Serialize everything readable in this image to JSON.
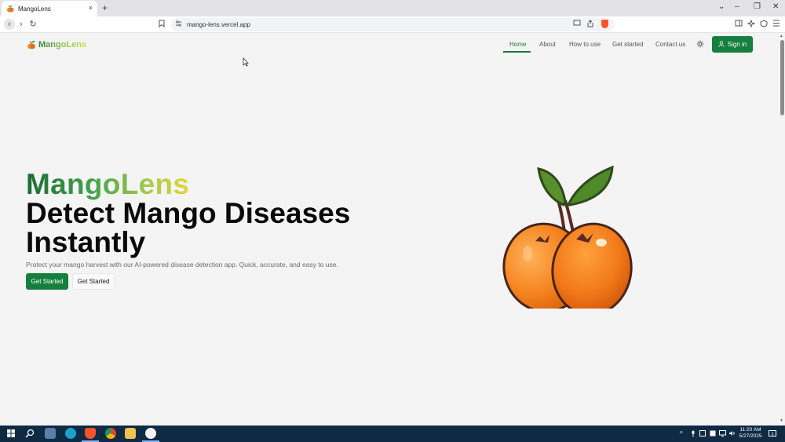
{
  "browser": {
    "tab_title": "MangoLens",
    "tab_close": "×",
    "new_tab": "+",
    "url": "mango-lens.vercel.app",
    "window_controls": [
      "⌄",
      "–",
      "❐",
      "✕"
    ],
    "nav_icons": {
      "back": "‹",
      "forward": "›",
      "reload": "↻",
      "bookmark": "bookmark-icon"
    }
  },
  "site": {
    "brand": "MangoLens",
    "nav": [
      {
        "label": "Home",
        "active": true
      },
      {
        "label": "About",
        "active": false
      },
      {
        "label": "How to use",
        "active": false
      },
      {
        "label": "Get started",
        "active": false
      },
      {
        "label": "Contact us",
        "active": false
      }
    ],
    "theme_toggle_icon": "sun-icon",
    "signin_label": "Sign in",
    "accent_color": "#15803d"
  },
  "hero": {
    "kicker": "MangoLens",
    "title": "Detect Mango Diseases Instantly",
    "subtitle": "Protect your mango harvest with our AI-powered disease detection app. Quick, accurate, and easy to use.",
    "primary_button": "Get Started",
    "secondary_button": "Get Started"
  },
  "taskbar": {
    "time": "11:20 AM",
    "date": "5/27/2025",
    "notification_count": "3"
  }
}
